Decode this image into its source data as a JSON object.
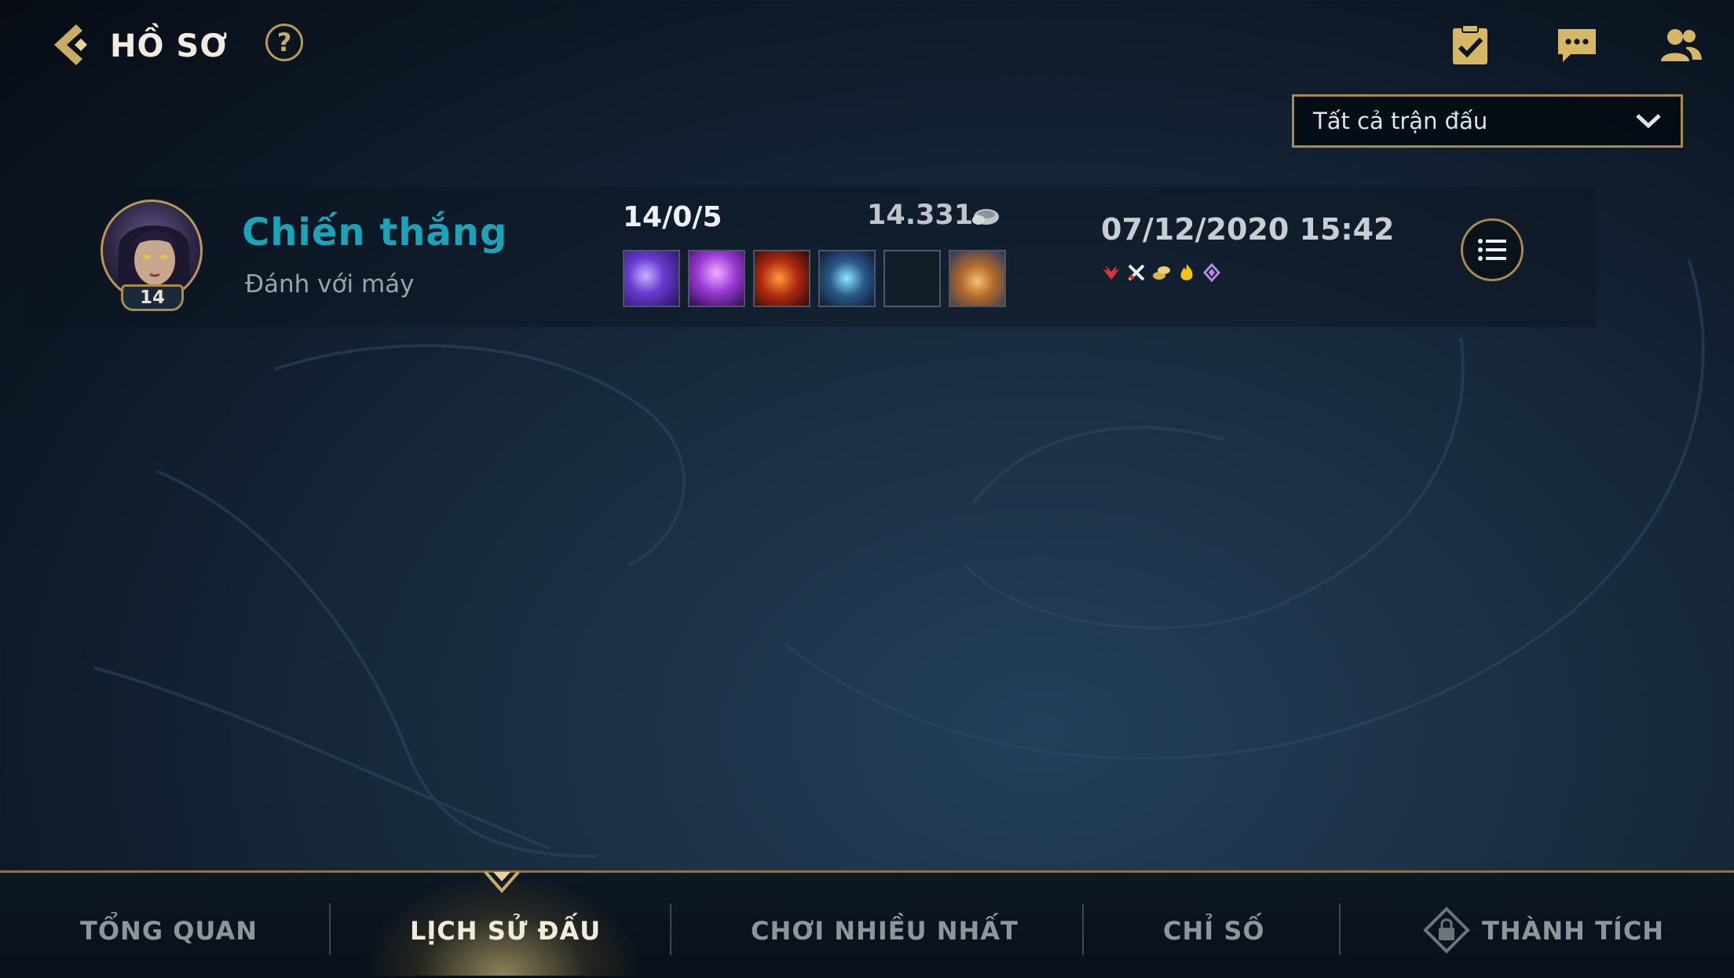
{
  "header": {
    "title": "HỒ SƠ",
    "help_label": "?",
    "icons": [
      "missions-icon",
      "chat-icon",
      "friends-icon"
    ]
  },
  "filter": {
    "selected": "Tất cả trận đấu"
  },
  "match": {
    "result": "Chiến thắng",
    "mode": "Đánh với máy",
    "champion_level": "14",
    "kda": "14/0/5",
    "gold": "14.331",
    "datetime": "07/12/2020 15:42",
    "items": [
      "item-1",
      "item-2",
      "item-3",
      "item-4",
      "item-empty",
      "item-6"
    ],
    "badges": [
      "red-wings-icon",
      "crossed-swords-icon",
      "gold-coins-icon",
      "fire-icon",
      "purple-gem-icon"
    ],
    "colors": {
      "result": "#1aa3b9",
      "gold_accent": "#a88a4a"
    }
  },
  "tabs": [
    {
      "label": "TỔNG QUAN",
      "active": false
    },
    {
      "label": "LỊCH SỬ ĐẤU",
      "active": true
    },
    {
      "label": "CHƠI NHIỀU NHẤT",
      "active": false
    },
    {
      "label": "CHỈ SỐ",
      "active": false
    },
    {
      "label": "THÀNH TÍCH",
      "active": false,
      "locked": true
    }
  ]
}
